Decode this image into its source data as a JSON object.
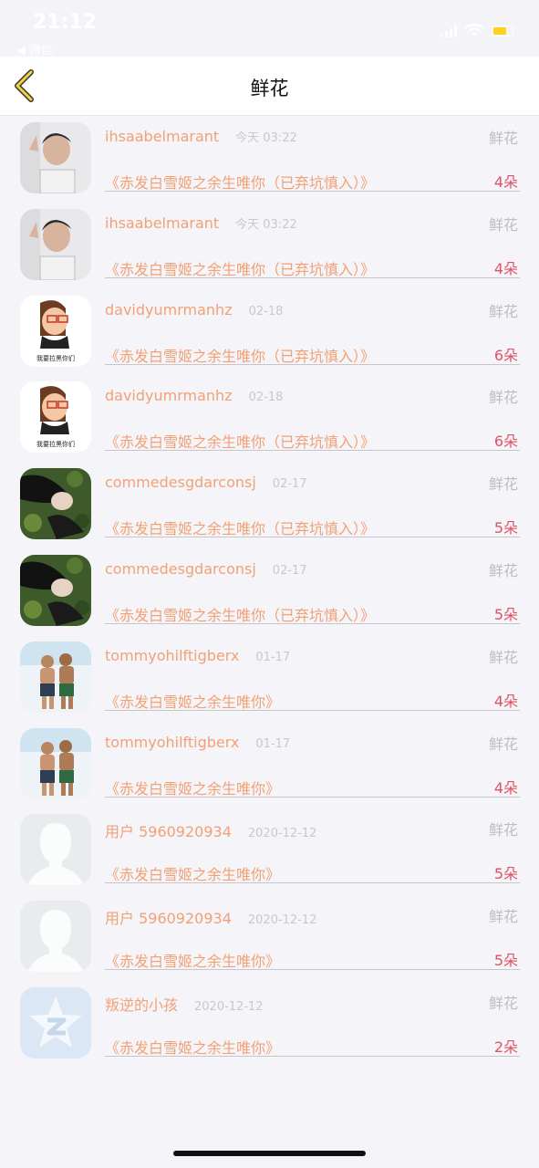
{
  "status_bar": {
    "time": "21:12",
    "back_app": "◀ 微信"
  },
  "nav": {
    "title": "鲜花"
  },
  "colors": {
    "accent": "#f2a174",
    "count": "#e05262",
    "meta": "#c9c9cd",
    "battery": "#ffd21e"
  },
  "rows": [
    {
      "username": "ihsaabelmarant",
      "time": "今天 03:22",
      "gift": "鲜花",
      "title": "《赤发白雪姬之余生唯你（已弃坑慎入）》",
      "count": "4朵",
      "avatar": "boy-photo"
    },
    {
      "username": "ihsaabelmarant",
      "time": "今天 03:22",
      "gift": "鲜花",
      "title": "《赤发白雪姬之余生唯你（已弃坑慎入）》",
      "count": "4朵",
      "avatar": "boy-photo"
    },
    {
      "username": "davidyumrmanhz",
      "time": "02-18",
      "gift": "鲜花",
      "title": "《赤发白雪姬之余生唯你（已弃坑慎入）》",
      "count": "6朵",
      "avatar": "cartoon-girl",
      "avatar_caption": "我要拉黑你们"
    },
    {
      "username": "davidyumrmanhz",
      "time": "02-18",
      "gift": "鲜花",
      "title": "《赤发白雪姬之余生唯你（已弃坑慎入）》",
      "count": "6朵",
      "avatar": "cartoon-girl",
      "avatar_caption": "我要拉黑你们"
    },
    {
      "username": "commedesgdarconsj",
      "time": "02-17",
      "gift": "鲜花",
      "title": "《赤发白雪姬之余生唯你（已弃坑慎入）》",
      "count": "5朵",
      "avatar": "girl-on-grass"
    },
    {
      "username": "commedesgdarconsj",
      "time": "02-17",
      "gift": "鲜花",
      "title": "《赤发白雪姬之余生唯你（已弃坑慎入）》",
      "count": "5朵",
      "avatar": "girl-on-grass"
    },
    {
      "username": "tommyohilftigberx",
      "time": "01-17",
      "gift": "鲜花",
      "title": "《赤发白雪姬之余生唯你》",
      "count": "4朵",
      "avatar": "beach-boys"
    },
    {
      "username": "tommyohilftigberx",
      "time": "01-17",
      "gift": "鲜花",
      "title": "《赤发白雪姬之余生唯你》",
      "count": "4朵",
      "avatar": "beach-boys"
    },
    {
      "username": "用户 5960920934",
      "time": "2020-12-12",
      "gift": "鲜花",
      "title": "《赤发白雪姬之余生唯你》",
      "count": "5朵",
      "avatar": "default-silhouette"
    },
    {
      "username": "用户 5960920934",
      "time": "2020-12-12",
      "gift": "鲜花",
      "title": "《赤发白雪姬之余生唯你》",
      "count": "5朵",
      "avatar": "default-silhouette"
    },
    {
      "username": "叛逆的小孩",
      "time": "2020-12-12",
      "gift": "鲜花",
      "title": "《赤发白雪姬之余生唯你》",
      "count": "2朵",
      "avatar": "qq-star-logo"
    }
  ]
}
